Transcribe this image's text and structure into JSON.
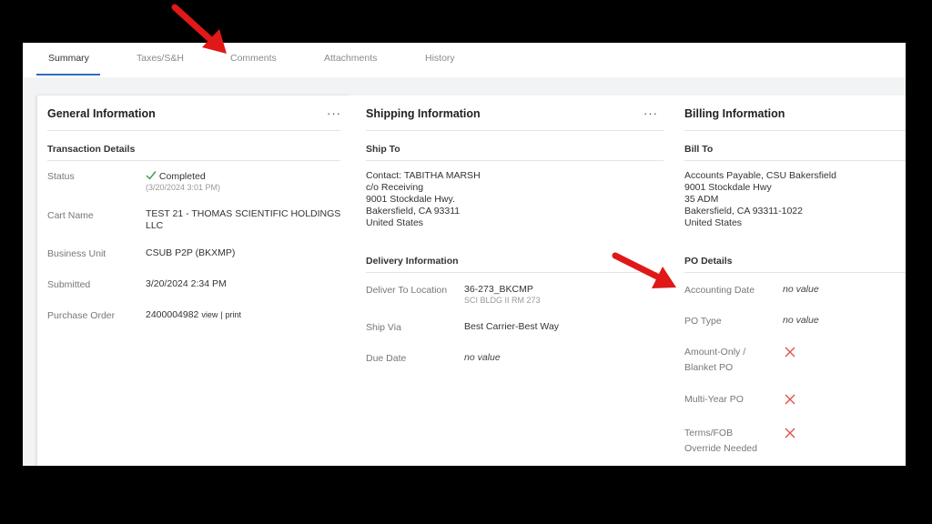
{
  "tabs": [
    {
      "label": "Summary"
    },
    {
      "label": "Taxes/S&H"
    },
    {
      "label": "Comments"
    },
    {
      "label": "Attachments"
    },
    {
      "label": "History"
    }
  ],
  "general": {
    "title": "General Information",
    "menu": "···",
    "section": "Transaction Details",
    "status_label": "Status",
    "status_value": "Completed",
    "status_time": "(3/20/2024 3:01 PM)",
    "cart_label": "Cart Name",
    "cart_value": "TEST 21 - THOMAS SCIENTIFIC HOLDINGS LLC",
    "bu_label": "Business Unit",
    "bu_value": "CSUB P2P (BKXMP)",
    "submitted_label": "Submitted",
    "submitted_value": "3/20/2024 2:34 PM",
    "po_label": "Purchase Order",
    "po_value": "2400004982",
    "po_view": "view",
    "po_sep": "|",
    "po_print": "print"
  },
  "shipping": {
    "title": "Shipping Information",
    "menu": "···",
    "ship_to_title": "Ship To",
    "address": [
      "Contact: TABITHA MARSH",
      "c/o Receiving",
      "9001 Stockdale Hwy.",
      "Bakersfield, CA 93311",
      "United States"
    ],
    "delivery_title": "Delivery Information",
    "deliver_label": "Deliver To Location",
    "deliver_value": "36-273_BKCMP",
    "deliver_sub": "SCI BLDG II RM 273",
    "shipvia_label": "Ship Via",
    "shipvia_value": "Best Carrier-Best Way",
    "duedate_label": "Due Date",
    "duedate_value": "no value"
  },
  "billing": {
    "title": "Billing Information",
    "bill_to_title": "Bill To",
    "address": [
      "Accounts Payable, CSU Bakersfield",
      "9001 Stockdale Hwy",
      "35 ADM",
      "Bakersfield, CA 93311-1022",
      "United States"
    ],
    "po_details_title": "PO Details",
    "accounting_label": "Accounting Date",
    "accounting_value": "no value",
    "potype_label": "PO Type",
    "potype_value": "no value",
    "amount_label_1": "Amount-Only /",
    "amount_label_2": "Blanket PO",
    "multiyear_label": "Multi-Year PO",
    "terms_label_1": "Terms/FOB",
    "terms_label_2": "Override Needed"
  },
  "colors": {
    "accent": "#2f6fbb",
    "check": "#3a9a4a",
    "x_mark": "#e05050",
    "arrow": "#e01818"
  }
}
